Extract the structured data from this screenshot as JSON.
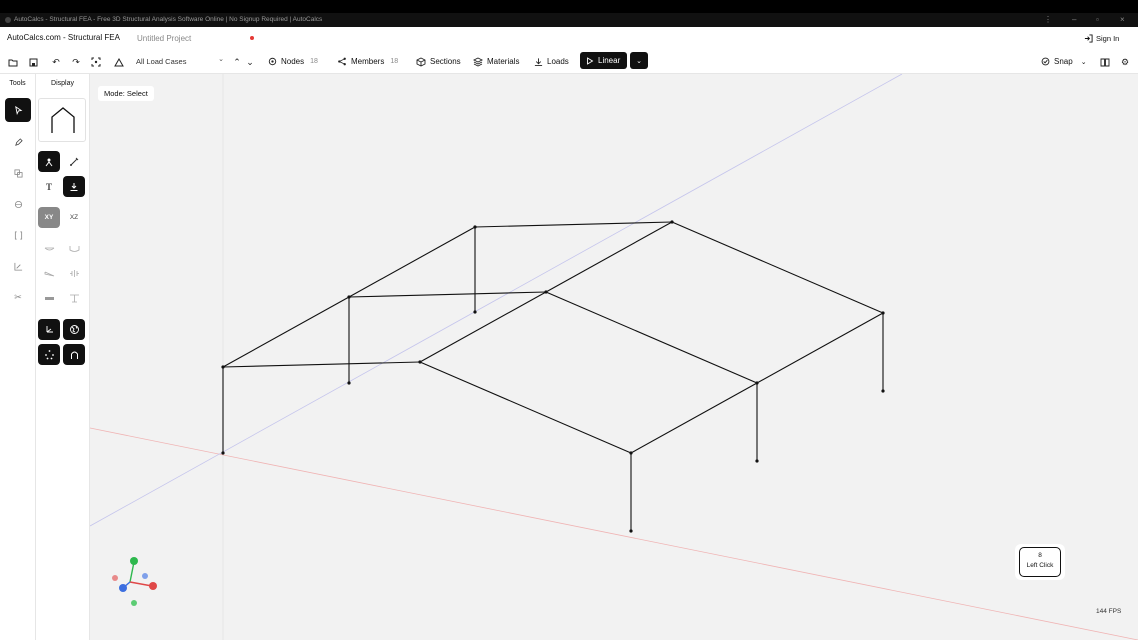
{
  "window": {
    "title": "AutoCalcs - Structural FEA - Free 3D Structural Analysis Software Online | No Signup Required | AutoCalcs"
  },
  "header": {
    "brand": "AutoCalcs.com - Structural FEA",
    "project_name": "Untitled Project",
    "sign_in": "Sign In"
  },
  "toolbar": {
    "load_case": "All Load Cases",
    "nodes_label": "Nodes",
    "nodes_count": "18",
    "members_label": "Members",
    "members_count": "18",
    "sections_label": "Sections",
    "materials_label": "Materials",
    "loads_label": "Loads",
    "analysis_label": "Linear",
    "snap_label": "Snap"
  },
  "left_panel": {
    "tools_header": "Tools",
    "display_header": "Display",
    "plane_xy": "XY",
    "plane_xz": "XZ",
    "text_tool": "T"
  },
  "viewport": {
    "mode": "Mode: Select",
    "mouse_key": "8",
    "mouse_action": "Left Click",
    "fps": "144 FPS"
  },
  "colors": {
    "accent": "#111111",
    "background": "#f2f2f2",
    "axis_x": "#e8a0a0",
    "axis_z": "#a8a8e8",
    "gizmo_y": "#2db84d",
    "gizmo_x": "#e04848",
    "gizmo_z": "#3c6fe0"
  },
  "icons": [
    "open-folder-icon",
    "save-icon",
    "undo-icon",
    "redo-icon",
    "fit-view-icon",
    "load-case-icon",
    "nodes-icon",
    "members-icon",
    "sections-icon",
    "materials-icon",
    "loads-icon",
    "play-icon",
    "chevron-down-icon",
    "snap-icon",
    "book-icon",
    "gear-icon",
    "sign-in-icon"
  ]
}
